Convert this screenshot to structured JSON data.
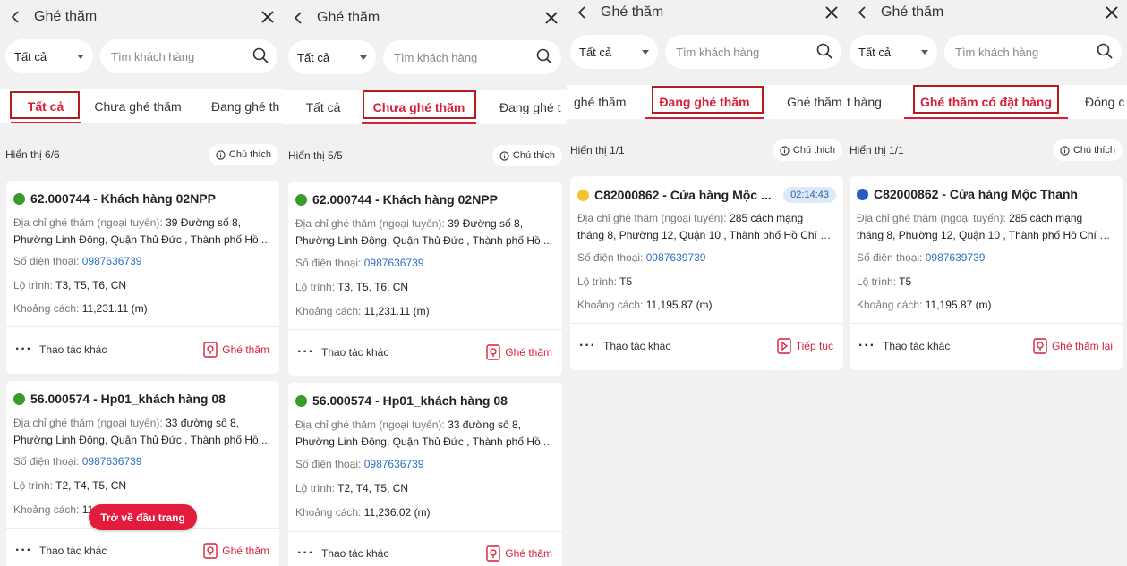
{
  "panels": [
    {
      "title": "Ghé thăm",
      "filter_value": "Tất cả",
      "search_placeholder": "Tìm khách hàng",
      "tabs": [
        "Tất cả",
        "Chưa ghé thăm",
        "Đang ghé th"
      ],
      "active_tab": "Tất cả",
      "count_text": "Hiển thị 6/6",
      "legend_label": "Chú thích",
      "cards": [
        {
          "title": "62.000744 - Khách hàng 02NPP",
          "status_color": "#3a9a2a",
          "address_label": "Địa chỉ ghé thăm (ngoại tuyến):",
          "address_part1": "39 Đường số 8,",
          "address_line2": "Phường Linh Đông, Quận Thủ Đức , Thành phố Hồ ...",
          "phone_label": "Số điện thoại:",
          "phone": "0987636739",
          "route_label": "Lộ trình:",
          "route": "T3, T5, T6, CN",
          "distance_label": "Khoảng cách:",
          "distance": "11,231.11 (m)",
          "more_label": "Thao tác khác",
          "action_label": "Ghé thăm"
        },
        {
          "title": "56.000574 - Hp01_khách hàng 08",
          "status_color": "#3a9a2a",
          "address_label": "Địa chỉ ghé thăm (ngoại tuyến):",
          "address_part1": "33 đường số 8,",
          "address_line2": "Phường Linh Đông, Quận Thủ Đức , Thành phố Hồ ...",
          "phone_label": "Số điện thoại:",
          "phone": "0987636739",
          "route_label": "Lộ trình:",
          "route": "T2, T4, T5, CN",
          "distance_label": "Khoảng cách:",
          "distance": "11",
          "more_label": "Thao tác khác",
          "action_label": "Ghé thăm"
        }
      ],
      "toast": "Trở về đầu trang"
    },
    {
      "title": "Ghé thăm",
      "filter_value": "Tất cả",
      "search_placeholder": "Tìm khách hàng",
      "tabs": [
        "Tất cả",
        "Chưa ghé thăm",
        "Đang ghé t"
      ],
      "active_tab": "Chưa ghé thăm",
      "count_text": "Hiển thị 5/5",
      "legend_label": "Chú thích",
      "cards": [
        {
          "title": "62.000744 - Khách hàng 02NPP",
          "status_color": "#3a9a2a",
          "address_label": "Địa chỉ ghé thăm (ngoại tuyến):",
          "address_part1": "39 Đường số 8,",
          "address_line2": "Phường Linh Đông, Quận Thủ Đức , Thành phố Hồ ...",
          "phone_label": "Số điện thoại:",
          "phone": "0987636739",
          "route_label": "Lộ trình:",
          "route": "T3, T5, T6, CN",
          "distance_label": "Khoảng cách:",
          "distance": "11,231.11 (m)",
          "more_label": "Thao tác khác",
          "action_label": "Ghé thăm"
        },
        {
          "title": "56.000574 - Hp01_khách hàng 08",
          "status_color": "#3a9a2a",
          "address_label": "Địa chỉ ghé thăm (ngoại tuyến):",
          "address_part1": "33 đường số 8,",
          "address_line2": "Phường Linh Đông, Quận Thủ Đức , Thành phố Hồ ...",
          "phone_label": "Số điện thoại:",
          "phone": "0987636739",
          "route_label": "Lộ trình:",
          "route": "T2, T4, T5, CN",
          "distance_label": "Khoảng cách:",
          "distance": "11,236.02 (m)",
          "more_label": "Thao tác khác",
          "action_label": "Ghé thăm"
        }
      ]
    },
    {
      "title": "Ghé thăm",
      "filter_value": "Tất cả",
      "search_placeholder": "Tìm khách hàng",
      "tabs": [
        "ghé thăm",
        "Đang ghé thăm",
        "Ghé thăm"
      ],
      "active_tab": "Đang ghé thăm",
      "count_text": "Hiển thị 1/1",
      "legend_label": "Chú thích",
      "cards": [
        {
          "title": "C82000862 - Cửa hàng Mộc ...",
          "status_color": "#f4c430",
          "timer": "02:14:43",
          "address_label": "Địa chỉ ghé thăm (ngoại tuyến):",
          "address_part1": "285 cách mạng",
          "address_line2": "tháng 8, Phường 12, Quận 10 , Thành phố Hồ Chí M...",
          "phone_label": "Số điện thoại:",
          "phone": "0987639739",
          "route_label": "Lộ trình:",
          "route": "T5",
          "distance_label": "Khoảng cách:",
          "distance": "11,195.87 (m)",
          "more_label": "Thao tác khác",
          "action_label": "Tiếp tục"
        }
      ]
    },
    {
      "title": "Ghé thăm",
      "filter_value": "Tất cả",
      "search_placeholder": "Tìm khách hàng",
      "tabs": [
        "t hàng",
        "Ghé thăm có đặt hàng",
        "Đóng c"
      ],
      "active_tab": "Ghé thăm có đặt hàng",
      "count_text": "Hiển thị 1/1",
      "legend_label": "Chú thích",
      "cards": [
        {
          "title": "C82000862 - Cửa hàng Mộc Thanh",
          "status_color": "#2a5cbf",
          "address_label": "Địa chỉ ghé thăm (ngoại tuyến):",
          "address_part1": "285 cách mạng",
          "address_line2": "tháng 8, Phường 12, Quận 10 , Thành phố Hồ Chí M...",
          "phone_label": "Số điện thoại:",
          "phone": "0987639739",
          "route_label": "Lộ trình:",
          "route": "T5",
          "distance_label": "Khoảng cách:",
          "distance": "11,195.87 (m)",
          "more_label": "Thao tác khác",
          "action_label": "Ghé thăm lại"
        }
      ]
    }
  ]
}
